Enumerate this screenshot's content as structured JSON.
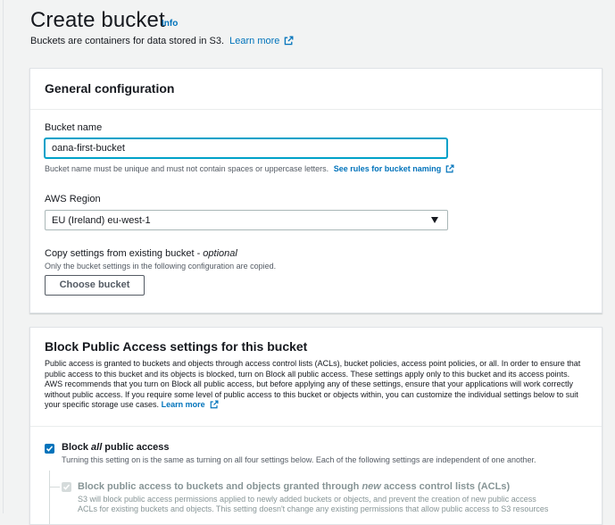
{
  "header": {
    "title": "Create bucket",
    "info_label": "Info",
    "subtitle": "Buckets are containers for data stored in S3.",
    "learn_more": "Learn more"
  },
  "general": {
    "title": "General configuration",
    "bucket_name_label": "Bucket name",
    "bucket_name_value": "oana-first-bucket",
    "bucket_name_hint": "Bucket name must be unique and must not contain spaces or uppercase letters.",
    "rules_link": "See rules for bucket naming",
    "region_label": "AWS Region",
    "region_value": "EU (Ireland) eu-west-1",
    "copy_label": "Copy settings from existing bucket - ",
    "copy_optional": "optional",
    "copy_hint": "Only the bucket settings in the following configuration are copied.",
    "choose_button": "Choose bucket"
  },
  "block_public": {
    "title": "Block Public Access settings for this bucket",
    "description": "Public access is granted to buckets and objects through access control lists (ACLs), bucket policies, access point policies, or all. In order to ensure that public access to this bucket and its objects is blocked, turn on Block all public access. These settings apply only to this bucket and its access points. AWS recommends that you turn on Block all public access, but before applying any of these settings, ensure that your applications will work correctly without public access. If you require some level of public access to this bucket or objects within, you can customize the individual settings below to suit your specific storage use cases.",
    "learn_more": "Learn more",
    "block_all": {
      "label_pre": "Block ",
      "label_em": "all",
      "label_post": " public access",
      "checked": true,
      "description": "Turning this setting on is the same as turning on all four settings below. Each of the following settings are independent of one another."
    },
    "sub_option_1": {
      "label_pre": "Block public access to buckets and objects granted through ",
      "label_em": "new",
      "label_post": " access control lists (ACLs)",
      "checked": true,
      "description_line1": "S3 will block public access permissions applied to newly added buckets or objects, and prevent the creation of new public access",
      "description_line2": "ACLs for existing buckets and objects. This setting doesn't change any existing permissions that allow public access to S3 resources"
    }
  },
  "colors": {
    "link": "#0073bb",
    "focus_border": "#00a1c9",
    "checkbox_on": "#0073bb",
    "page_background": "#f2f3f3"
  }
}
